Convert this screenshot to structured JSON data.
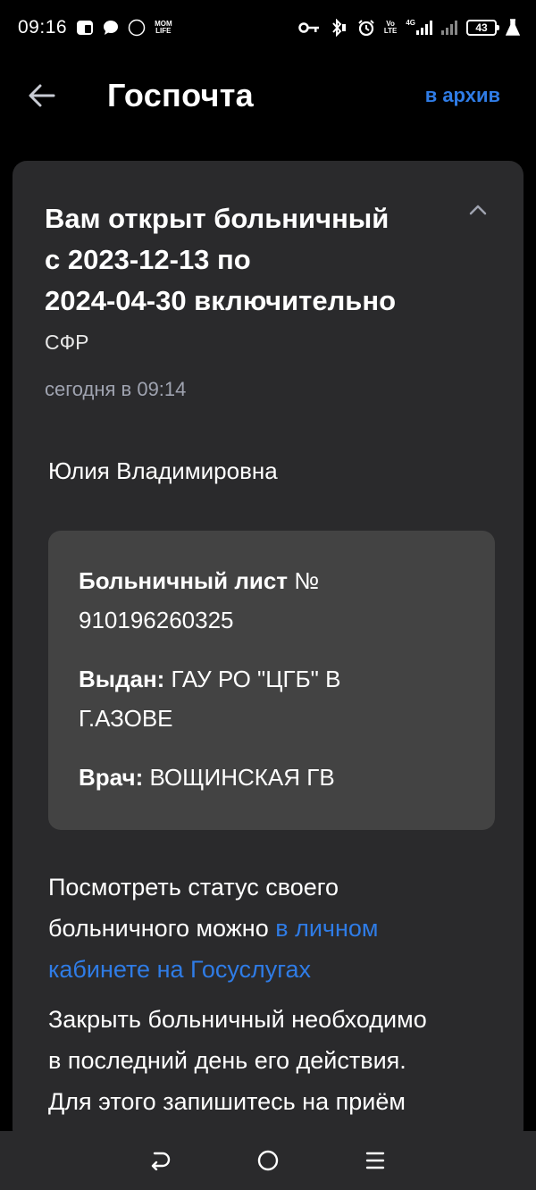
{
  "status_bar": {
    "time": "09:16",
    "battery": "43",
    "network": "4G",
    "volte_top": "Vo",
    "volte_bottom": "LTE",
    "notif_mom_top": "MOM",
    "notif_mom_bottom": "LIFE",
    "notif_circle": "Rfimo"
  },
  "header": {
    "title": "Госпочта",
    "archive_label": "в архив"
  },
  "message": {
    "title_line1": "Вам открыт больничный",
    "title_line2": "с 2023-12-13 по",
    "title_line3": "2024-04-30 включительно",
    "sender": "СФР",
    "time": "сегодня в 09:14",
    "greeting": "Юлия Владимировна",
    "info": {
      "sick_leave_label": "Больничный лист",
      "sick_leave_number_sign": " №",
      "sick_leave_number": "910196260325",
      "issued_label": "Выдан:",
      "issued_value_line1": " ГАУ РО \"ЦГБ\" В",
      "issued_value_line2": "Г.АЗОВЕ",
      "doctor_label": "Врач:",
      "doctor_value": " ВОЩИНСКАЯ ГВ"
    },
    "status_text_line1": "Посмотреть статус своего",
    "status_text_line2": "больничного можно ",
    "status_link_line1": "в личном",
    "status_link_line2": "кабинете на Госуслугах",
    "close_text_line1": "Закрыть больничный необходимо",
    "close_text_line2": "в последний день его действия.",
    "close_text_line3": "Для этого запишитесь на приём"
  },
  "icons": {
    "back": "arrow-left-icon",
    "collapse": "chevron-up-icon",
    "nav_back": "nav-back-icon",
    "nav_home": "nav-home-icon",
    "nav_menu": "nav-menu-icon"
  },
  "colors": {
    "background": "#000000",
    "card": "#2a2a2c",
    "info_box": "#434343",
    "link": "#2f7ce6",
    "muted": "#9fa3b0"
  }
}
